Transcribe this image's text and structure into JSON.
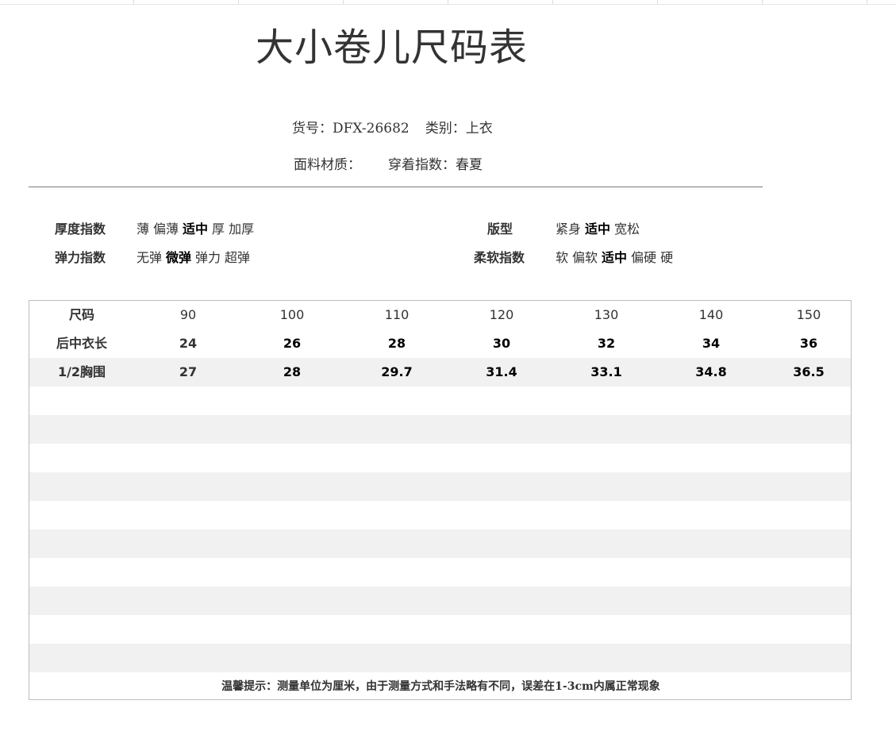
{
  "title": "大小卷儿尺码表",
  "meta": {
    "item_no_label": "货号：",
    "item_no": "DFX-26682",
    "category_label": "类别：",
    "category": "上衣",
    "fabric_label": "面料材质：",
    "fabric": "",
    "season_label": "穿着指数：",
    "season": "春夏"
  },
  "indices": {
    "thickness": {
      "label": "厚度指数",
      "options": [
        "薄",
        "偏薄",
        "适中",
        "厚",
        "加厚"
      ],
      "selected": "适中"
    },
    "elasticity": {
      "label": "弹力指数",
      "options": [
        "无弹",
        "微弹",
        "弹力",
        "超弹"
      ],
      "selected": "微弹"
    },
    "fit": {
      "label": "版型",
      "options": [
        "紧身",
        "适中",
        "宽松"
      ],
      "selected": "适中"
    },
    "softness": {
      "label": "柔软指数",
      "options": [
        "软",
        "偏软",
        "适中",
        "偏硬",
        "硬"
      ],
      "selected": "适中"
    }
  },
  "table": {
    "sizes_label": "尺码",
    "sizes": [
      "90",
      "100",
      "110",
      "120",
      "130",
      "140",
      "150"
    ],
    "rows": [
      {
        "label": "后中衣长",
        "values": [
          "24",
          "26",
          "28",
          "30",
          "32",
          "34",
          "36"
        ]
      },
      {
        "label": "1/2胸围",
        "values": [
          "27",
          "28",
          "29.7",
          "31.4",
          "33.1",
          "34.8",
          "36.5"
        ]
      }
    ],
    "note": "温馨提示：测量单位为厘米，由于测量方式和手法略有不同，误差在1-3cm内属正常现象"
  }
}
